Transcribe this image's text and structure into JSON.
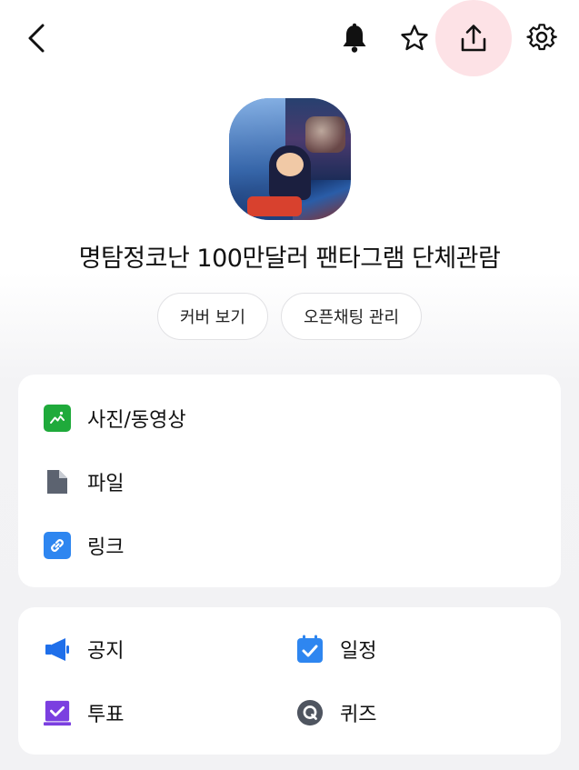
{
  "header": {
    "back_icon": "chevron-left-icon",
    "actions": [
      {
        "name": "notifications",
        "icon": "bell-icon"
      },
      {
        "name": "favorite",
        "icon": "star-icon"
      },
      {
        "name": "share",
        "icon": "share-icon"
      },
      {
        "name": "settings",
        "icon": "gear-icon"
      }
    ],
    "share_highlight_color": "#fde2e6"
  },
  "chat": {
    "title": "명탐정코난 100만달러 팬타그램 단체관람"
  },
  "buttons": {
    "view_cover": "커버 보기",
    "manage_open_chat": "오픈채팅 관리"
  },
  "media_menu": {
    "items": [
      {
        "label": "사진/동영상",
        "icon": "photo-icon",
        "color": "#1faa3b"
      },
      {
        "label": "파일",
        "icon": "file-icon",
        "color": "#5c6370"
      },
      {
        "label": "링크",
        "icon": "link-icon",
        "color": "#2e86f0"
      }
    ]
  },
  "tools_menu": {
    "items": [
      {
        "label": "공지",
        "icon": "megaphone-icon",
        "color": "#1f6fea"
      },
      {
        "label": "일정",
        "icon": "calendar-icon",
        "color": "#2e86f0"
      },
      {
        "label": "투표",
        "icon": "vote-icon",
        "color": "#7b3fe0"
      },
      {
        "label": "퀴즈",
        "icon": "quiz-icon",
        "color": "#4f5560"
      }
    ]
  }
}
